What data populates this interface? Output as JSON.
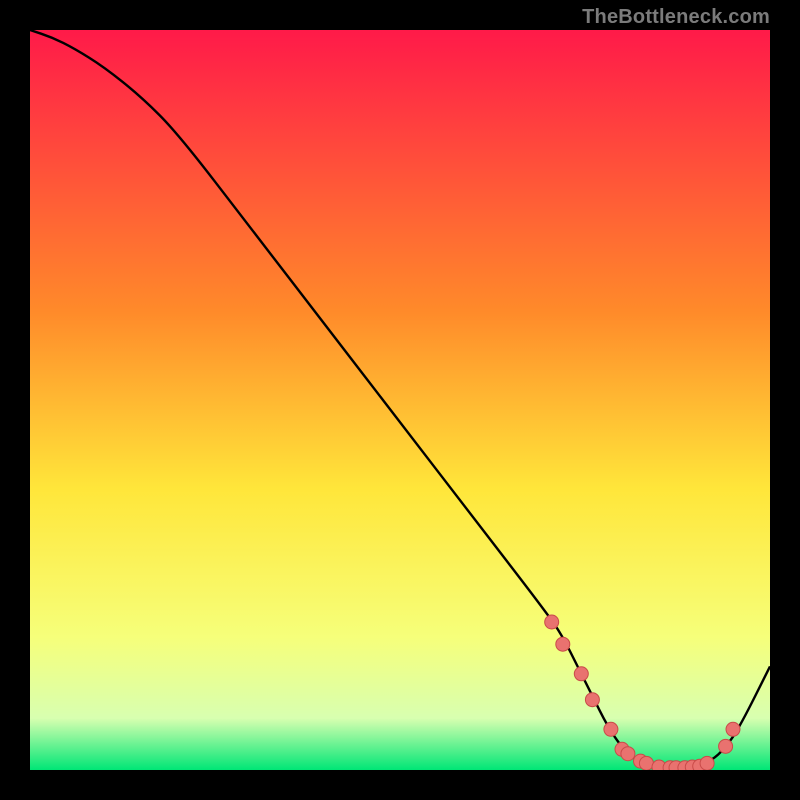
{
  "attribution": "TheBottleneck.com",
  "colors": {
    "bg": "#000000",
    "grad_top": "#ff1a49",
    "grad_mid1": "#ff8a2a",
    "grad_mid2": "#ffe63a",
    "grad_low1": "#f6ff7a",
    "grad_low2": "#d8ffb0",
    "grad_bottom": "#00e676",
    "curve": "#000000",
    "marker_fill": "#e9726f",
    "marker_stroke": "#c94b49"
  },
  "chart_data": {
    "type": "line",
    "title": "",
    "xlabel": "",
    "ylabel": "",
    "xlim": [
      0,
      100
    ],
    "ylim": [
      0,
      100
    ],
    "x": [
      0,
      3,
      6,
      10,
      15,
      20,
      30,
      40,
      50,
      60,
      70,
      72,
      74,
      76,
      78,
      80,
      82,
      84,
      86,
      88,
      90,
      92,
      94,
      96,
      100
    ],
    "values": [
      100,
      99,
      97.5,
      95,
      91,
      86,
      73,
      60,
      47,
      34,
      21,
      18,
      14,
      10,
      6,
      3,
      1.2,
      0.6,
      0.3,
      0.3,
      0.6,
      1.2,
      3,
      6,
      14
    ],
    "markers_x": [
      70.5,
      72,
      74.5,
      76,
      78.5,
      80,
      80.8,
      82.5,
      83.3,
      85,
      86.5,
      87.3,
      88.5,
      89.5,
      90.5,
      91.5,
      94,
      95
    ],
    "markers_y": [
      20,
      17,
      13,
      9.5,
      5.5,
      2.8,
      2.2,
      1.2,
      0.9,
      0.4,
      0.3,
      0.3,
      0.3,
      0.4,
      0.5,
      0.9,
      3.2,
      5.5
    ]
  }
}
